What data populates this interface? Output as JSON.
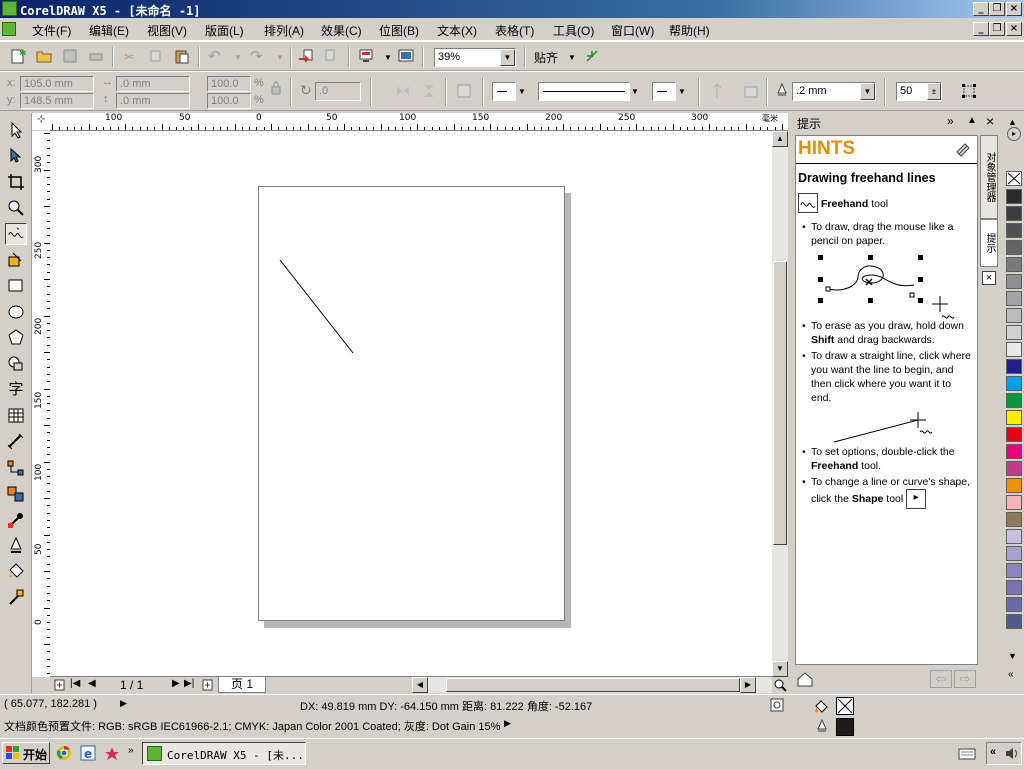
{
  "window": {
    "title": "CorelDRAW X5 - [未命名 -1]"
  },
  "menu": [
    "文件(F)",
    "编辑(E)",
    "视图(V)",
    "版面(L)",
    "排列(A)",
    "效果(C)",
    "位图(B)",
    "文本(X)",
    "表格(T)",
    "工具(O)",
    "窗口(W)",
    "帮助(H)"
  ],
  "toolbar": {
    "zoom_value": "39%",
    "snap_label": "贴齐"
  },
  "property_bar": {
    "x_label": "x:",
    "x_value": "105.0 mm",
    "y_label": "y:",
    "y_value": "148.5 mm",
    "w_value": ".0 mm",
    "h_value": ".0 mm",
    "scale_w": "100.0",
    "scale_h": "100.0",
    "pct": "%",
    "angle_value": ".0",
    "outline_width": ".2 mm",
    "smoothing": "50"
  },
  "ruler": {
    "h_labels": [
      "100",
      "50",
      "0",
      "50",
      "100",
      "150",
      "200",
      "250",
      "300"
    ],
    "h_unit": "毫米",
    "v_labels": [
      "300",
      "250",
      "200",
      "150",
      "100",
      "50",
      "0"
    ]
  },
  "pagebar": {
    "page_count": "1 / 1",
    "tab_label": "页 1"
  },
  "docker": {
    "title": "提示",
    "heading": "HINTS",
    "subtitle": "Drawing freehand lines",
    "tool_name": "Freehand",
    "tool_suffix": " tool",
    "tabs": [
      "对象管理器",
      "提示"
    ],
    "bullets": [
      {
        "text": "To draw, drag the mouse like a pencil on paper."
      },
      {
        "pre": "To erase as you draw, hold down ",
        "bold": "Shift",
        "post": " and drag backwards."
      },
      {
        "text": "To draw a straight line, click where you want the line to begin, and then click where you want it to end."
      },
      {
        "pre": "To set options, double-click the ",
        "bold": "Freehand",
        "post": " tool."
      },
      {
        "pre": "To change a line or curve's shape, click the ",
        "bold": "Shape",
        "post": " tool"
      }
    ]
  },
  "palette": [
    "#ffffff",
    "#2a2a2a",
    "#3c3c3c",
    "#505050",
    "#646464",
    "#7a7a7a",
    "#8e8e8e",
    "#a4a4a4",
    "#bababa",
    "#d0d0d0",
    "#e8e8e8",
    "#1e1e8c",
    "#00a0e6",
    "#009640",
    "#ffed00",
    "#e30016",
    "#e6007e",
    "#c0398a",
    "#f39200",
    "#f5b4b4",
    "#8c7a5a",
    "#c8c0dc",
    "#a8a0cc",
    "#8c84c0",
    "#7a72b4",
    "#646ca8",
    "#505a8c"
  ],
  "status": {
    "coords": "( 65.077, 182.281 )",
    "delta": "DX: 49.819 mm DY: -64.150 mm 距离: 81.222 角度: -52.167",
    "profile": "文档颜色预置文件: RGB: sRGB IEC61966-2.1; CMYK: Japan Color 2001 Coated; 灰度: Dot Gain 15%"
  },
  "taskbar": {
    "start_label": "开始",
    "task_label": "CorelDRAW X5 - [未..."
  }
}
